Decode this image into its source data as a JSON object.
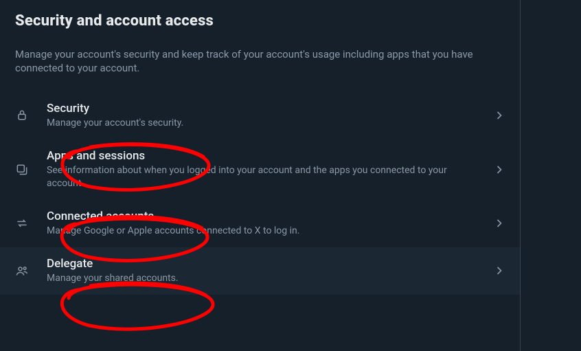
{
  "page": {
    "title": "Security and account access",
    "description": "Manage your account's security and keep track of your account's usage including apps that you have connected to your account."
  },
  "items": [
    {
      "title": "Security",
      "subtitle": "Manage your account's security."
    },
    {
      "title": "Apps and sessions",
      "subtitle": "See information about when you logged into your account and the apps you connected to your account."
    },
    {
      "title": "Connected accounts",
      "subtitle": "Manage Google or Apple accounts connected to X to log in."
    },
    {
      "title": "Delegate",
      "subtitle": "Manage your shared accounts."
    }
  ],
  "annotations": {
    "color": "#ff0000",
    "circled_items": [
      "Apps and sessions",
      "Connected accounts",
      "Delegate"
    ]
  }
}
